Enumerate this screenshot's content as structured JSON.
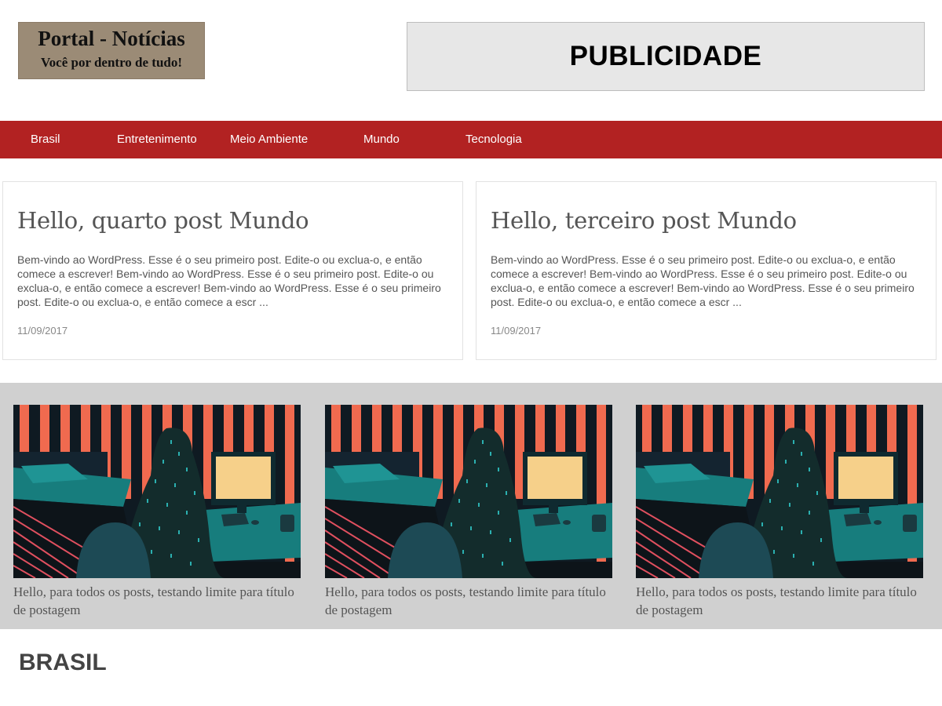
{
  "header": {
    "logo_title": "Portal - Notícias",
    "logo_tagline": "Você por dentro de tudo!",
    "ad_text": "PUBLICIDADE"
  },
  "nav": {
    "items": [
      "Brasil",
      "Entretenimento",
      "Meio Ambiente",
      "Mundo",
      "Tecnologia"
    ]
  },
  "posts": [
    {
      "title": "Hello, quarto post Mundo",
      "excerpt": "Bem-vindo ao WordPress. Esse é o seu primeiro post. Edite-o ou exclua-o, e então comece a escrever! Bem-vindo ao WordPress. Esse é o seu primeiro post. Edite-o ou exclua-o, e então comece a escrever! Bem-vindo ao WordPress. Esse é o seu primeiro post. Edite-o ou exclua-o, e então comece a escr ...",
      "date": "11/09/2017"
    },
    {
      "title": "Hello, terceiro post Mundo",
      "excerpt": "Bem-vindo ao WordPress. Esse é o seu primeiro post. Edite-o ou exclua-o, e então comece a escrever! Bem-vindo ao WordPress. Esse é o seu primeiro post. Edite-o ou exclua-o, e então comece a escrever! Bem-vindo ao WordPress. Esse é o seu primeiro post. Edite-o ou exclua-o, e então comece a escr ...",
      "date": "11/09/2017"
    }
  ],
  "featured": [
    {
      "caption": "Hello, para todos os posts, testando limite para título de postagem"
    },
    {
      "caption": "Hello, para todos os posts, testando limite para título de postagem"
    },
    {
      "caption": "Hello, para todos os posts, testando limite para título de postagem"
    }
  ],
  "section": {
    "heading": "BRASIL"
  },
  "colors": {
    "nav_bg": "#b22222",
    "logo_bg": "#9b8b76",
    "ad_bg": "#e7e7e7",
    "featured_bg": "#d0d0d0",
    "illustration_stripe": "#f06a4f",
    "illustration_dark": "#0f1a22",
    "illustration_teal": "#177d7d",
    "illustration_screen": "#f6d08a"
  }
}
